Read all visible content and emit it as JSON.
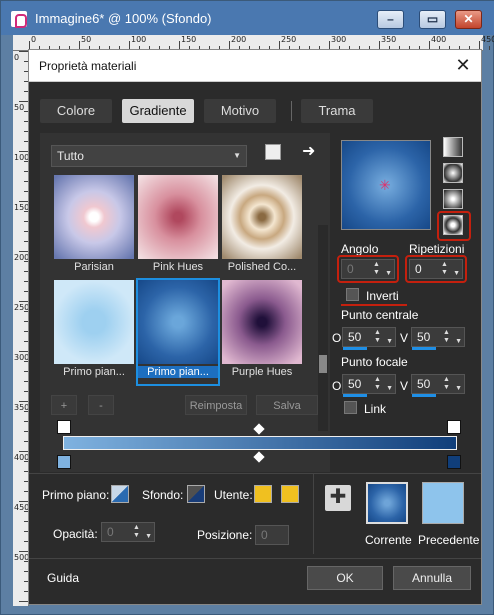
{
  "window": {
    "title": "Immagine6* @ 100% (Sfondo)"
  },
  "ruler": {
    "top_numbers": [
      "0",
      "50",
      "100",
      "150",
      "200",
      "250",
      "300",
      "350",
      "400",
      "450"
    ],
    "left_numbers": [
      "0",
      "50",
      "100",
      "150",
      "200",
      "250",
      "300",
      "350",
      "400",
      "450",
      "500"
    ]
  },
  "dialog": {
    "title": "Proprietà materiali"
  },
  "tabs": [
    {
      "label": "Colore"
    },
    {
      "label": "Gradiente"
    },
    {
      "label": "Motivo"
    },
    {
      "label": "Trama"
    }
  ],
  "category": {
    "selected": "Tutto"
  },
  "gradients": [
    {
      "label": "Parisian"
    },
    {
      "label": "Pink Hues"
    },
    {
      "label": "Polished Co..."
    },
    {
      "label": "Primo pian..."
    },
    {
      "label": "Primo pian..."
    },
    {
      "label": "Purple Hues"
    }
  ],
  "buttons": {
    "add": "+",
    "remove": "-",
    "reset": "Reimposta",
    "save": "Salva",
    "ok": "OK",
    "cancel": "Annulla",
    "help": "Guida"
  },
  "angle": {
    "label": "Angolo",
    "value": "0"
  },
  "repeats": {
    "label": "Ripetizioni",
    "value": "0"
  },
  "invert": {
    "label": "Inverti"
  },
  "center": {
    "label": "Punto centrale",
    "o_label": "O",
    "v_label": "V",
    "o_value": "50",
    "v_value": "50"
  },
  "focal": {
    "label": "Punto focale",
    "o_label": "O",
    "v_label": "V",
    "o_value": "50",
    "v_value": "50"
  },
  "link": {
    "label": "Link"
  },
  "bottom": {
    "foreground_label": "Primo piano:",
    "background_label": "Sfondo:",
    "user_label": "Utente:",
    "opacity_label": "Opacità:",
    "opacity_value": "0",
    "position_label": "Posizione:",
    "position_value": "0",
    "current_label": "Corrente",
    "previous_label": "Precedente"
  },
  "colors": {
    "accent": "#1d8fe0",
    "gradient_start": "#7fb2e0",
    "gradient_end": "#103e7a",
    "user_color": "#f0c020",
    "annotation_red": "#c4200e"
  }
}
